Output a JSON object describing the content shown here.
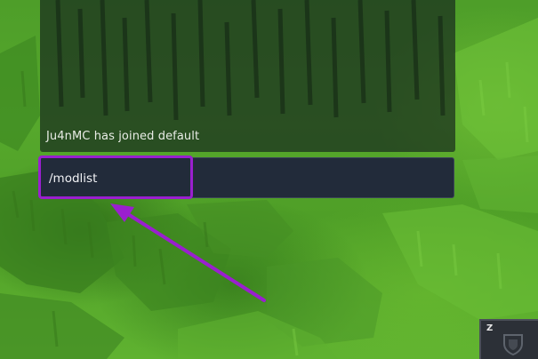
{
  "chat": {
    "messages": [
      "Ju4nMC has joined default"
    ],
    "input_value": "/modlist"
  },
  "hotbar": {
    "slot_key": "Z",
    "slot_icon": "shield-icon"
  },
  "annotation": {
    "color": "#9a1fcf"
  }
}
